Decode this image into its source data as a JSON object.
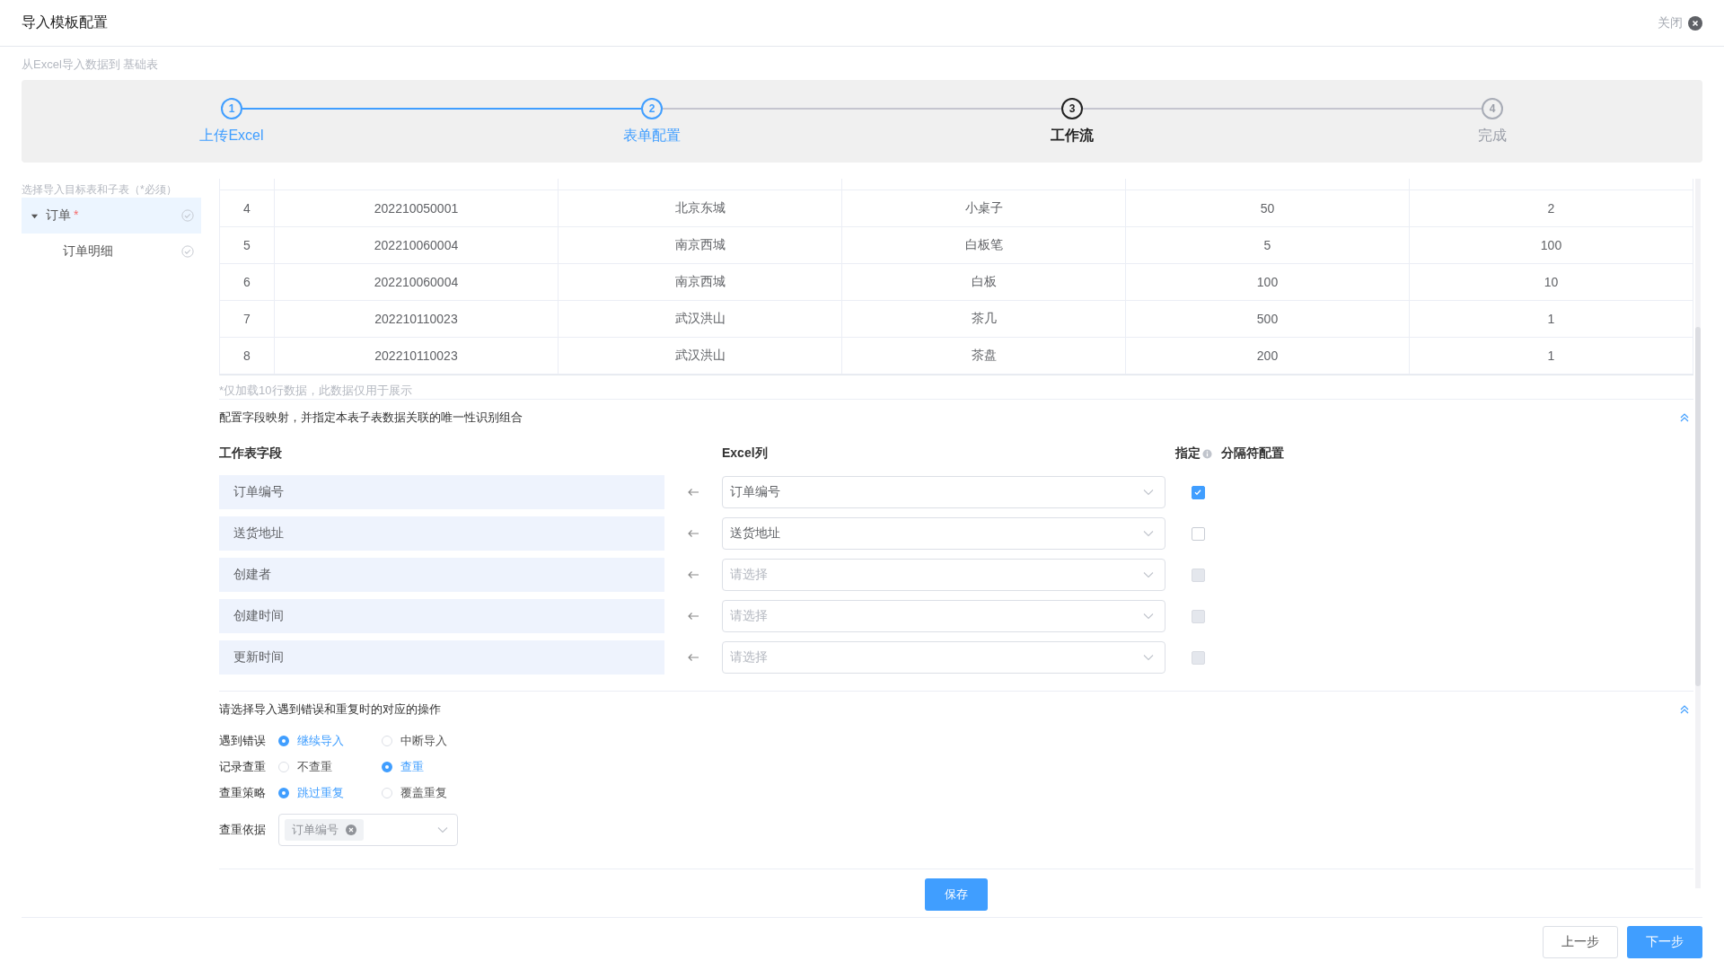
{
  "dialog": {
    "title": "导入模板配置",
    "close_label": "关闭"
  },
  "subtitle": "从Excel导入数据到 基础表",
  "steps": [
    {
      "number": "1",
      "label": "上传Excel",
      "completed": true,
      "selected": false
    },
    {
      "number": "2",
      "label": "表单配置",
      "completed": true,
      "selected": false
    },
    {
      "number": "3",
      "label": "工作流",
      "completed": false,
      "selected": true
    },
    {
      "number": "4",
      "label": "完成",
      "completed": false,
      "selected": false
    }
  ],
  "sidebar": {
    "hint": "选择导入目标表和子表（*必须）",
    "items": [
      {
        "label": "订单",
        "required_mark": "*",
        "expanded": true,
        "selected": true,
        "children": [
          {
            "label": "订单明细",
            "selected": false
          }
        ]
      }
    ]
  },
  "preview": {
    "rows": [
      {
        "index": "4",
        "cells": [
          "202210050001",
          "北京东城",
          "小桌子",
          "50",
          "2"
        ]
      },
      {
        "index": "5",
        "cells": [
          "202210060004",
          "南京西城",
          "白板笔",
          "5",
          "100"
        ]
      },
      {
        "index": "6",
        "cells": [
          "202210060004",
          "南京西城",
          "白板",
          "100",
          "10"
        ]
      },
      {
        "index": "7",
        "cells": [
          "202210110023",
          "武汉洪山",
          "茶几",
          "500",
          "1"
        ]
      },
      {
        "index": "8",
        "cells": [
          "202210110023",
          "武汉洪山",
          "茶盘",
          "200",
          "1"
        ]
      }
    ],
    "note": "*仅加载10行数据，此数据仅用于展示"
  },
  "mapping": {
    "title": "配置字段映射，并指定本表子表数据关联的唯一性识别组合",
    "headers": {
      "field": "工作表字段",
      "column": "Excel列",
      "designate": "指定",
      "separator": "分隔符配置"
    },
    "rows": [
      {
        "field": "订单编号",
        "value": "订单编号",
        "checked": true,
        "disabled": false
      },
      {
        "field": "送货地址",
        "value": "送货地址",
        "checked": false,
        "disabled": false
      },
      {
        "field": "创建者",
        "placeholder": "请选择",
        "checked": false,
        "disabled": true
      },
      {
        "field": "创建时间",
        "placeholder": "请选择",
        "checked": false,
        "disabled": true
      },
      {
        "field": "更新时间",
        "placeholder": "请选择",
        "checked": false,
        "disabled": true
      }
    ]
  },
  "options": {
    "title": "请选择导入遇到错误和重复时的对应的操作",
    "rows": [
      {
        "label": "遇到错误",
        "choices": [
          {
            "label": "继续导入",
            "selected": true
          },
          {
            "label": "中断导入",
            "selected": false
          }
        ]
      },
      {
        "label": "记录查重",
        "choices": [
          {
            "label": "不查重",
            "selected": false
          },
          {
            "label": "查重",
            "selected": true
          }
        ]
      },
      {
        "label": "查重策略",
        "choices": [
          {
            "label": "跳过重复",
            "selected": true
          },
          {
            "label": "覆盖重复",
            "selected": false
          }
        ]
      }
    ],
    "basis": {
      "label": "查重依据",
      "tags": [
        "订单编号"
      ]
    }
  },
  "buttons": {
    "save": "保存",
    "prev": "上一步",
    "next": "下一步"
  }
}
